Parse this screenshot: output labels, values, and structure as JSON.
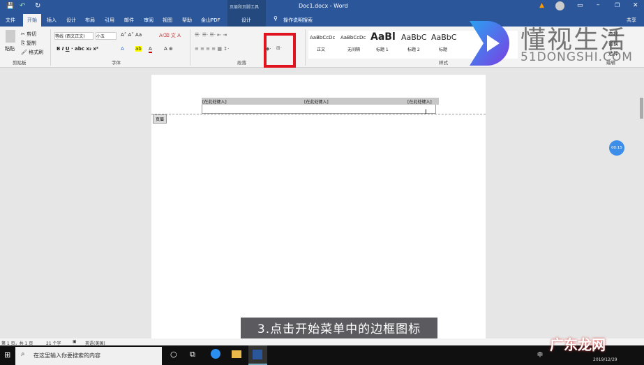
{
  "title_bar": {
    "context_tools": "页眉和页脚工具",
    "doc_title": "Doc1.docx - Word"
  },
  "tabs": [
    "文件",
    "开始",
    "插入",
    "设计",
    "布局",
    "引用",
    "邮件",
    "审阅",
    "视图",
    "帮助",
    "金山PDF",
    "设计"
  ],
  "tell_me": "操作说明搜索",
  "share": "共享",
  "clipboard": {
    "paste": "粘贴",
    "cut": "剪切",
    "copy": "复制",
    "format_painter": "格式刷",
    "group": "剪贴板"
  },
  "font": {
    "name": "等线 (西文正文)",
    "size": "小五",
    "group": "字体"
  },
  "paragraph": {
    "group": "段落"
  },
  "styles": {
    "items": [
      {
        "preview": "AaBbCcDc",
        "label": "正文"
      },
      {
        "preview": "AaBbCcDc",
        "label": "无间隔"
      },
      {
        "preview": "AaBl",
        "label": "标题 1"
      },
      {
        "preview": "AaBbC",
        "label": "标题 2"
      },
      {
        "preview": "AaBbC",
        "label": "标题"
      }
    ],
    "group": "样式"
  },
  "editing": {
    "group": "编辑",
    "find": "查找",
    "replace": "替换",
    "select": "选择"
  },
  "document": {
    "header_cells": [
      "[在此处键入]",
      "[在此处键入]",
      "[在此处键入]"
    ],
    "header_label": "页眉"
  },
  "caption": "3.点击开始菜单中的边框图标",
  "timer": "00:15",
  "status": {
    "page": "第 1 页，共 1 页",
    "words": "21 个字",
    "language": "英语(美国)"
  },
  "taskbar": {
    "search_placeholder": "在这里输入你要搜索的内容",
    "date": "2019/12/29",
    "ime": "中"
  },
  "watermark": {
    "brand": "懂视生活",
    "url": "51DONGSHI.COM",
    "corner": "广东龙网"
  },
  "colors": {
    "accent": "#2b579a",
    "highlight": "#e0141e"
  }
}
